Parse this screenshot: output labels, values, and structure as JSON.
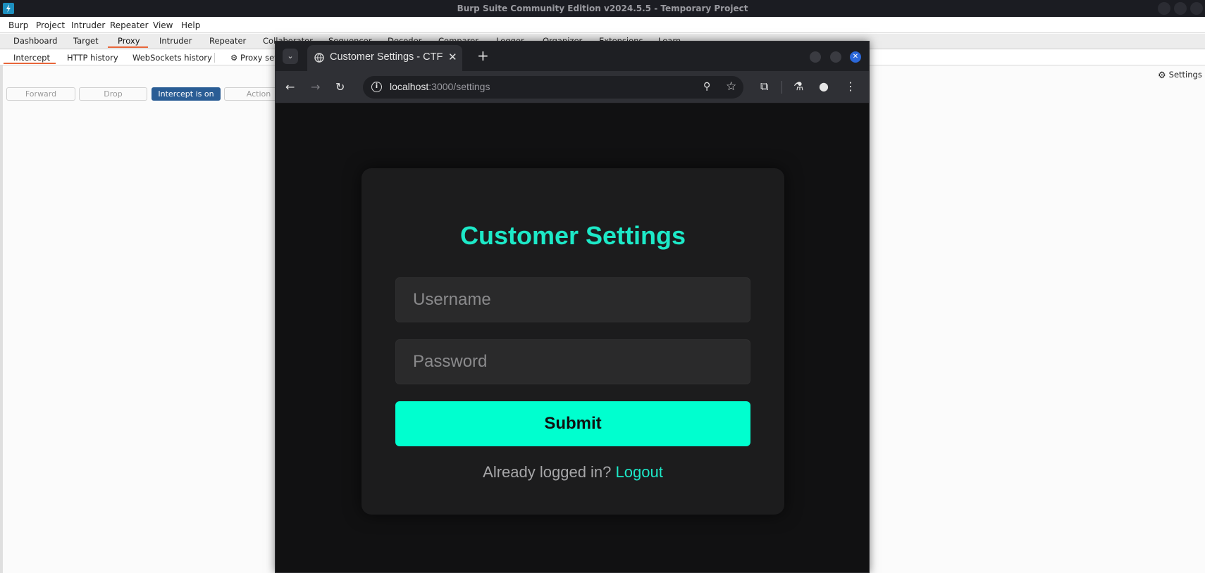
{
  "burp": {
    "window_title": "Burp Suite Community Edition v2024.5.5 - Temporary Project",
    "menu": [
      "Burp",
      "Project",
      "Intruder",
      "Repeater",
      "View",
      "Help"
    ],
    "tabs": [
      "Dashboard",
      "Target",
      "Proxy",
      "Intruder",
      "Repeater",
      "Collaborator",
      "Sequencer",
      "Decoder",
      "Comparer",
      "Logger",
      "Organizer",
      "Extensions",
      "Learn"
    ],
    "active_tab": "Proxy",
    "settings_label": "Settings",
    "subtabs": [
      "Intercept",
      "HTTP history",
      "WebSockets history"
    ],
    "proxy_settings_label": "Proxy sett",
    "intercept_buttons": {
      "forward": "Forward",
      "drop": "Drop",
      "intercept": "Intercept is on",
      "action": "Action"
    },
    "accent_color": "#e8663a",
    "intercept_on_color": "#2a5d95"
  },
  "browser": {
    "tab_title": "Customer Settings - CTF",
    "url_host": "localhost",
    "url_path": ":3000/settings"
  },
  "page": {
    "title": "Customer Settings",
    "username_placeholder": "Username",
    "password_placeholder": "Password",
    "submit_label": "Submit",
    "footer_text": "Already logged in?",
    "logout_link": "Logout",
    "accent_color": "#1de9c8",
    "button_color": "#00ffcf"
  }
}
